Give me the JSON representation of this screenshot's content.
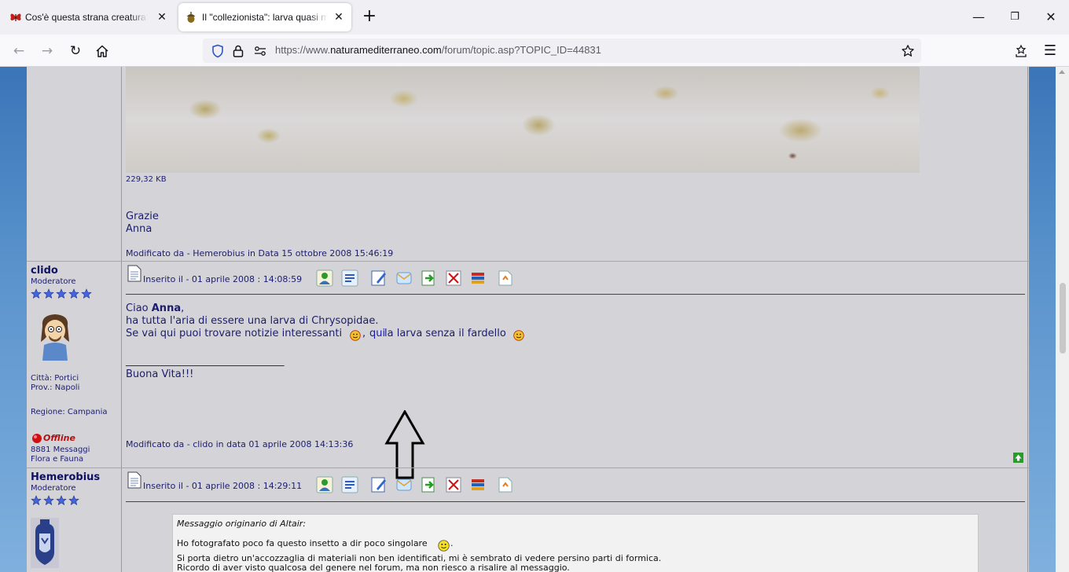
{
  "browser": {
    "tabs": [
      {
        "title": "Cos'è questa strana creatura? , Fo",
        "active": false,
        "icon": "butterfly-icon"
      },
      {
        "title": "Il \"collezionista\": larva quasi mai",
        "active": true,
        "icon": "acorn-icon"
      }
    ],
    "url": {
      "prefix": "https://www.",
      "host": "naturamediterraneo.com",
      "path": "/forum/topic.asp?TOPIC_ID=44831"
    }
  },
  "posts": [
    {
      "attachment_size": "229,32 KB",
      "body_lines": [
        "Grazie",
        "Anna"
      ],
      "edited": "Modificato da - Hemerobius in Data 15 ottobre 2008 15:46:19"
    },
    {
      "author": "clido",
      "role": "Moderatore",
      "stars": 5,
      "city": "Città: Portici",
      "province": "Prov.: Napoli",
      "region": "Regione: Campania",
      "status": "Offline",
      "messages": "8881 Messaggi",
      "section": "Flora e Fauna",
      "posted": "Inserito il - 01 aprile 2008 : 14:08:59",
      "greeting": "Ciao ",
      "greeting_name": "Anna",
      "greeting_end": ",",
      "line2": "ha tutta l'aria di essere una larva di Chrysopidae.",
      "line3_a": "Se vai qui puoi trovare notizie interessanti ",
      "line3_comma": ",",
      "line3_link": "qui",
      "line3_b": " la larva senza il fardello ",
      "signature_rule": "_______________________________",
      "signature": "Buona Vita!!!",
      "edited": "Modificato da - clido in data 01 aprile 2008 14:13:36"
    },
    {
      "author": "Hemerobius",
      "role": "Moderatore",
      "stars": 4,
      "posted": "Inserito il - 01 aprile 2008 : 14:29:11",
      "quote_header": "Messaggio originario di Altair:",
      "quote_line1": "Ho fotografato poco fa questo insetto a dir poco singolare ",
      "quote_line1_end": ".",
      "quote_line2": "Si porta dietro un'accozzaglia di materiali non ben identificati, mi è sembrato di vedere persino parti di formica.",
      "quote_line3": "Ricordo di aver visto qualcosa del genere nel forum, ma non riesco a risalire al messaggio."
    }
  ]
}
